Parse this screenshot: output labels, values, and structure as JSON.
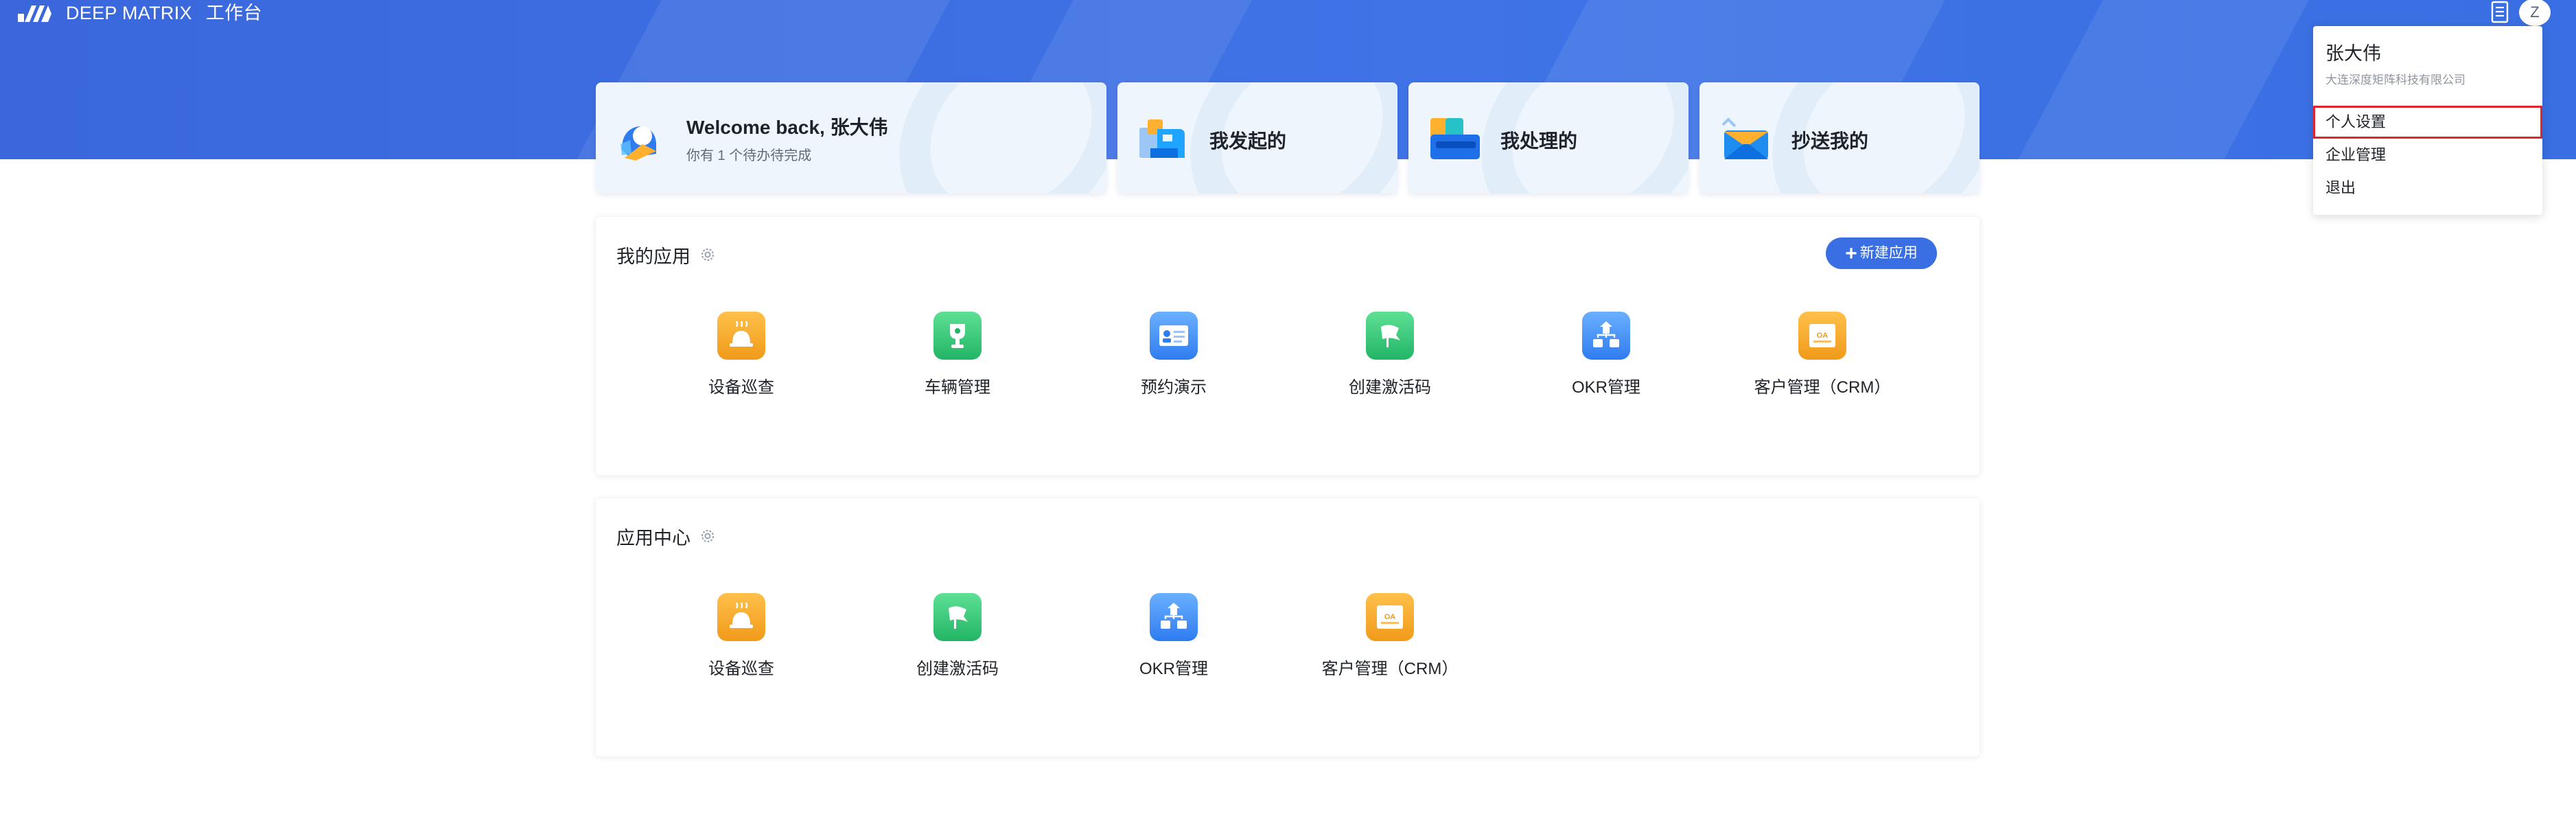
{
  "topbar": {
    "brand_name": "DEEP MATRIX",
    "workspace_label": "工作台",
    "avatar_initial": "Z"
  },
  "welcome_card": {
    "title": "Welcome back, 张大伟",
    "subtitle": "你有 1 个待办待完成"
  },
  "quick_cards": [
    {
      "label": "我发起的",
      "icon": "initiated-icon"
    },
    {
      "label": "我处理的",
      "icon": "processed-icon"
    },
    {
      "label": "抄送我的",
      "icon": "cc-mail-icon"
    }
  ],
  "my_apps": {
    "title": "我的应用",
    "new_app_label": "新建应用",
    "items": [
      {
        "label": "设备巡查",
        "icon": "cloche-icon",
        "color": "orange"
      },
      {
        "label": "车辆管理",
        "icon": "trophy-icon",
        "color": "green"
      },
      {
        "label": "预约演示",
        "icon": "id-card-icon",
        "color": "blue"
      },
      {
        "label": "创建激活码",
        "icon": "flag-icon",
        "color": "green"
      },
      {
        "label": "OKR管理",
        "icon": "org-chart-icon",
        "color": "blue"
      },
      {
        "label": "客户管理（CRM）",
        "icon": "oa-icon",
        "color": "orange"
      }
    ]
  },
  "app_center": {
    "title": "应用中心",
    "items": [
      {
        "label": "设备巡查",
        "icon": "cloche-icon",
        "color": "orange"
      },
      {
        "label": "创建激活码",
        "icon": "flag-icon",
        "color": "green"
      },
      {
        "label": "OKR管理",
        "icon": "org-chart-icon",
        "color": "blue"
      },
      {
        "label": "客户管理（CRM）",
        "icon": "oa-icon",
        "color": "orange"
      }
    ]
  },
  "user_menu": {
    "name": "张大伟",
    "company": "大连深度矩阵科技有限公司",
    "items": [
      "个人设置",
      "企业管理",
      "退出"
    ],
    "highlighted_item": "个人设置"
  },
  "colors": {
    "primary": "#3a6fe3",
    "highlight_border": "#e0242c"
  }
}
